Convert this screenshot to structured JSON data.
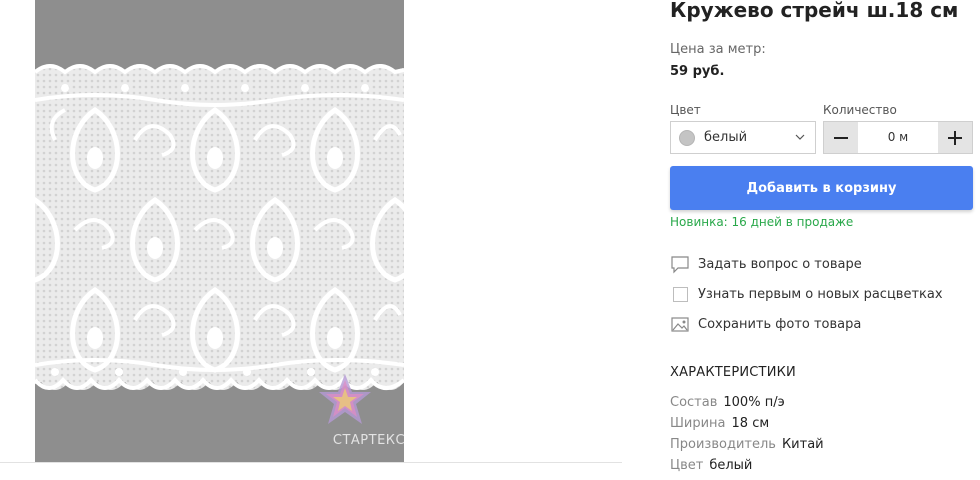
{
  "product": {
    "title": "Кружево стрейч ш.18 см",
    "price_label": "Цена за метр:",
    "price_value": "59 руб."
  },
  "options": {
    "color_label": "Цвет",
    "color_value": "белый",
    "quantity_label": "Количество",
    "quantity_value": "0 м",
    "minus_icon": "minus-icon",
    "plus_icon": "plus-icon"
  },
  "add_to_cart": "Добавить в корзину",
  "new_note": "Новинка: 16 дней в продаже",
  "actions": [
    {
      "icon": "chat-bubble-icon",
      "label": "Задать вопрос о товаре"
    },
    {
      "icon": "checkbox-icon",
      "label": "Узнать первым о новых расцветках"
    },
    {
      "icon": "photo-icon",
      "label": "Сохранить фото товара"
    }
  ],
  "specs": {
    "title": "ХАРАКТЕРИСТИКИ",
    "rows": [
      {
        "key": "Состав",
        "value": "100% п/э"
      },
      {
        "key": "Ширина",
        "value": "18 см"
      },
      {
        "key": "Производитель",
        "value": "Китай"
      },
      {
        "key": "Цвет",
        "value": "белый"
      }
    ]
  },
  "watermark": "СТАРТЕКС",
  "colors": {
    "accent": "#4a7ff0",
    "new_note": "#29a84a",
    "photo_bg": "#8e8e8e",
    "swatch": "#c4c4c4"
  }
}
